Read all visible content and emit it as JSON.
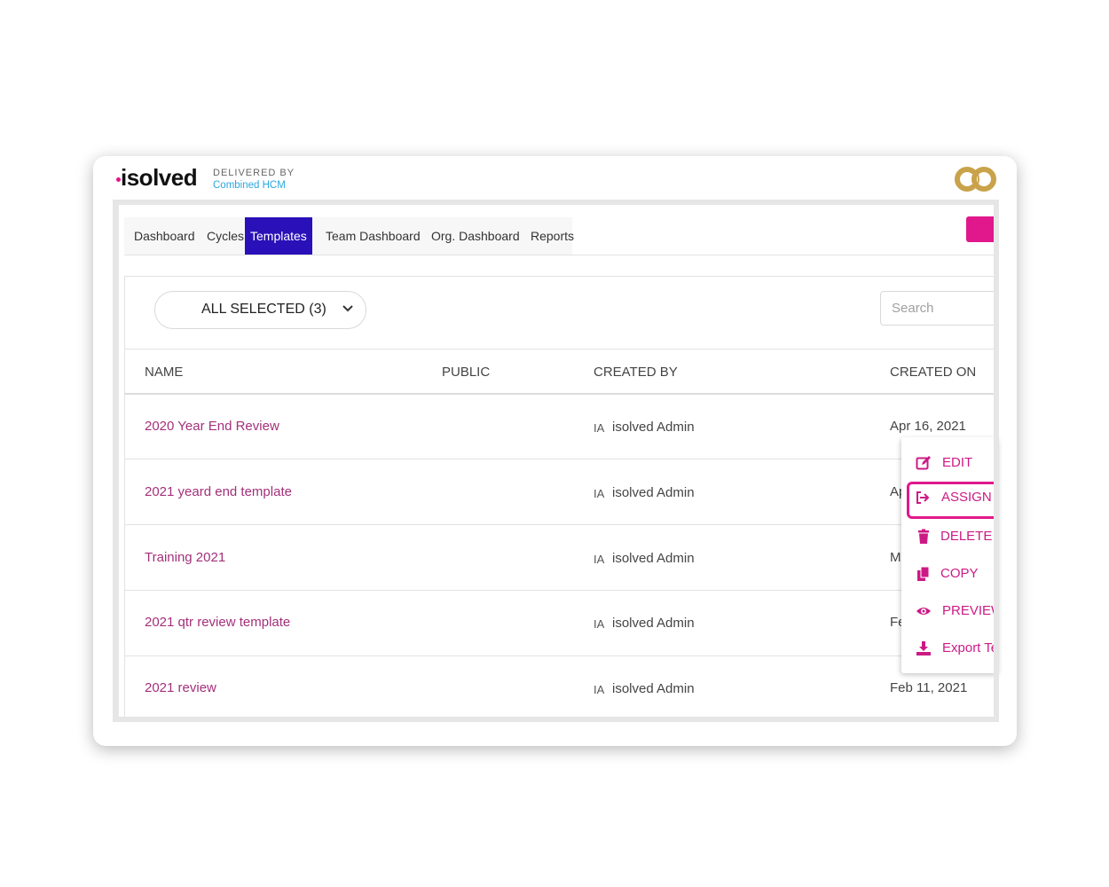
{
  "brand": {
    "logo": "isolved",
    "delivered_by": "DELIVERED BY",
    "partner": "Combined HCM",
    "partner_logo": "CO"
  },
  "colors": {
    "accent": "#e0188c",
    "active_tab": "#2a10b8",
    "link": "#a3307a",
    "partner_blue": "#29a8e0",
    "partner_gold": "#c9a24a"
  },
  "tabs": [
    {
      "label": "Dashboard"
    },
    {
      "label": "Cycles"
    },
    {
      "label": "Templates",
      "active": true
    },
    {
      "label": "Team Dashboard"
    },
    {
      "label": "Org. Dashboard"
    },
    {
      "label": "Reports"
    }
  ],
  "new_button": {
    "label": "+"
  },
  "filter": {
    "label": "ALL SELECTED (3)",
    "icon": "chevron-down-icon"
  },
  "search": {
    "placeholder": "Search"
  },
  "table": {
    "columns": [
      "NAME",
      "PUBLIC",
      "CREATED BY",
      "CREATED ON"
    ],
    "rows": [
      {
        "name": "2020 Year End Review",
        "initials": "IA",
        "created_by": "isolved Admin",
        "created_on": "Apr 16, 2021"
      },
      {
        "name": "2021 yeard end template",
        "initials": "IA",
        "created_by": "isolved Admin",
        "created_on": "Ap"
      },
      {
        "name": "Training 2021",
        "initials": "IA",
        "created_by": "isolved Admin",
        "created_on": "M"
      },
      {
        "name": "2021 qtr review template",
        "initials": "IA",
        "created_by": "isolved Admin",
        "created_on": "Fe"
      },
      {
        "name": "2021 review",
        "initials": "IA",
        "created_by": "isolved Admin",
        "created_on": "Feb 11, 2021"
      }
    ]
  },
  "context_menu": {
    "items": [
      {
        "label": "EDIT",
        "icon": "edit-icon"
      },
      {
        "label": "ASSIGN",
        "icon": "assign-icon",
        "highlighted": true
      },
      {
        "label": "DELETE",
        "icon": "trash-icon"
      },
      {
        "label": "COPY",
        "icon": "copy-icon"
      },
      {
        "label": "PREVIEW",
        "icon": "eye-icon"
      },
      {
        "label": "Export Template",
        "icon": "download-icon"
      }
    ]
  }
}
